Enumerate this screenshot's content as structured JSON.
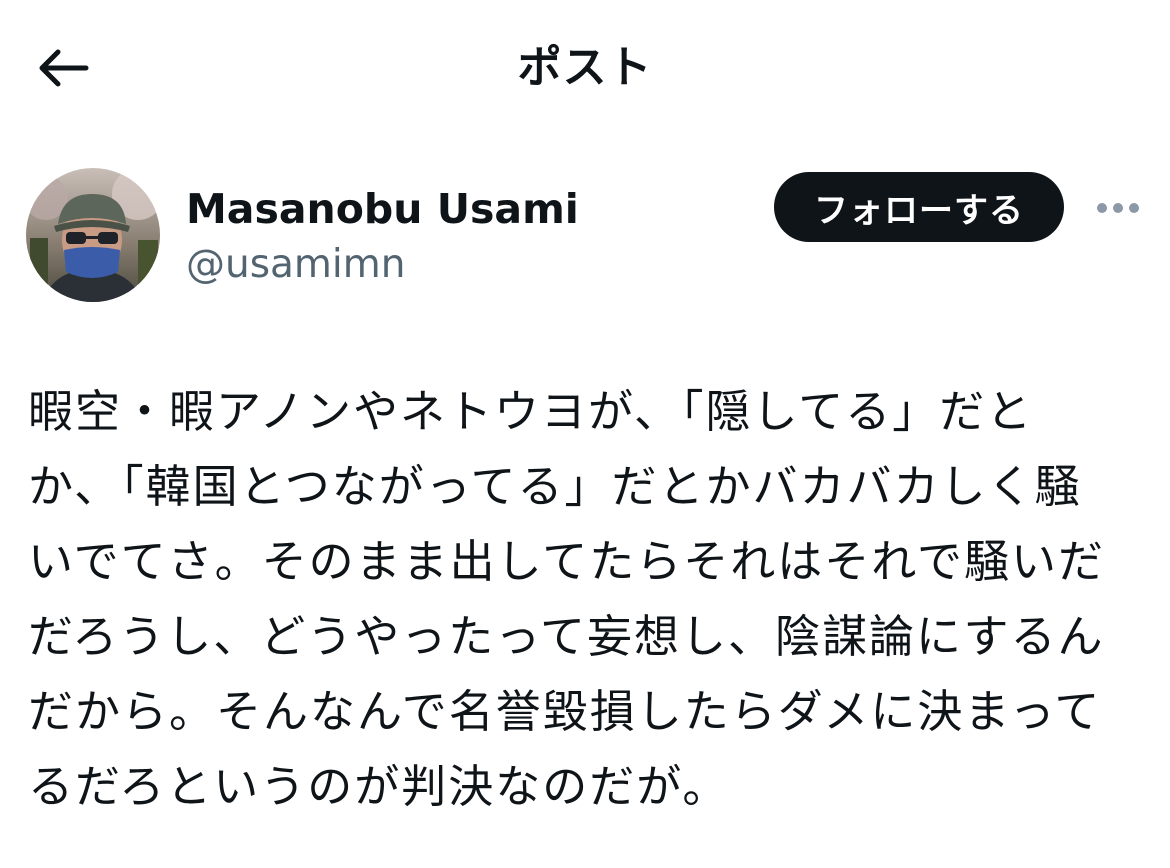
{
  "header": {
    "title": "ポスト",
    "back_icon": "arrow-left-icon"
  },
  "author": {
    "name": "Masanobu Usami",
    "handle": "@usamimn",
    "avatar": "avatar-photo-masked-man-in-cap"
  },
  "actions": {
    "follow_label": "フォローする",
    "more_icon": "more-horizontal-icon"
  },
  "post": {
    "lines": [
      "暇空・暇アノンやネトウヨが、「隠してる」だと",
      "か、「韓国とつながってる」だとかバカバカしく騒",
      "いでてさ。そのまま出してたらそれはそれで騒いだ",
      "だろうし、どうやったって妄想し、陰謀論にするん",
      "だから。そんなんで名誉毀損したらダメに決まって",
      "るだろというのが判決なのだが。"
    ]
  },
  "colors": {
    "text_primary": "#0f1419",
    "text_secondary": "#536471",
    "follow_bg": "#0f1419",
    "follow_text": "#ffffff",
    "more_dots": "#8b98a5"
  }
}
